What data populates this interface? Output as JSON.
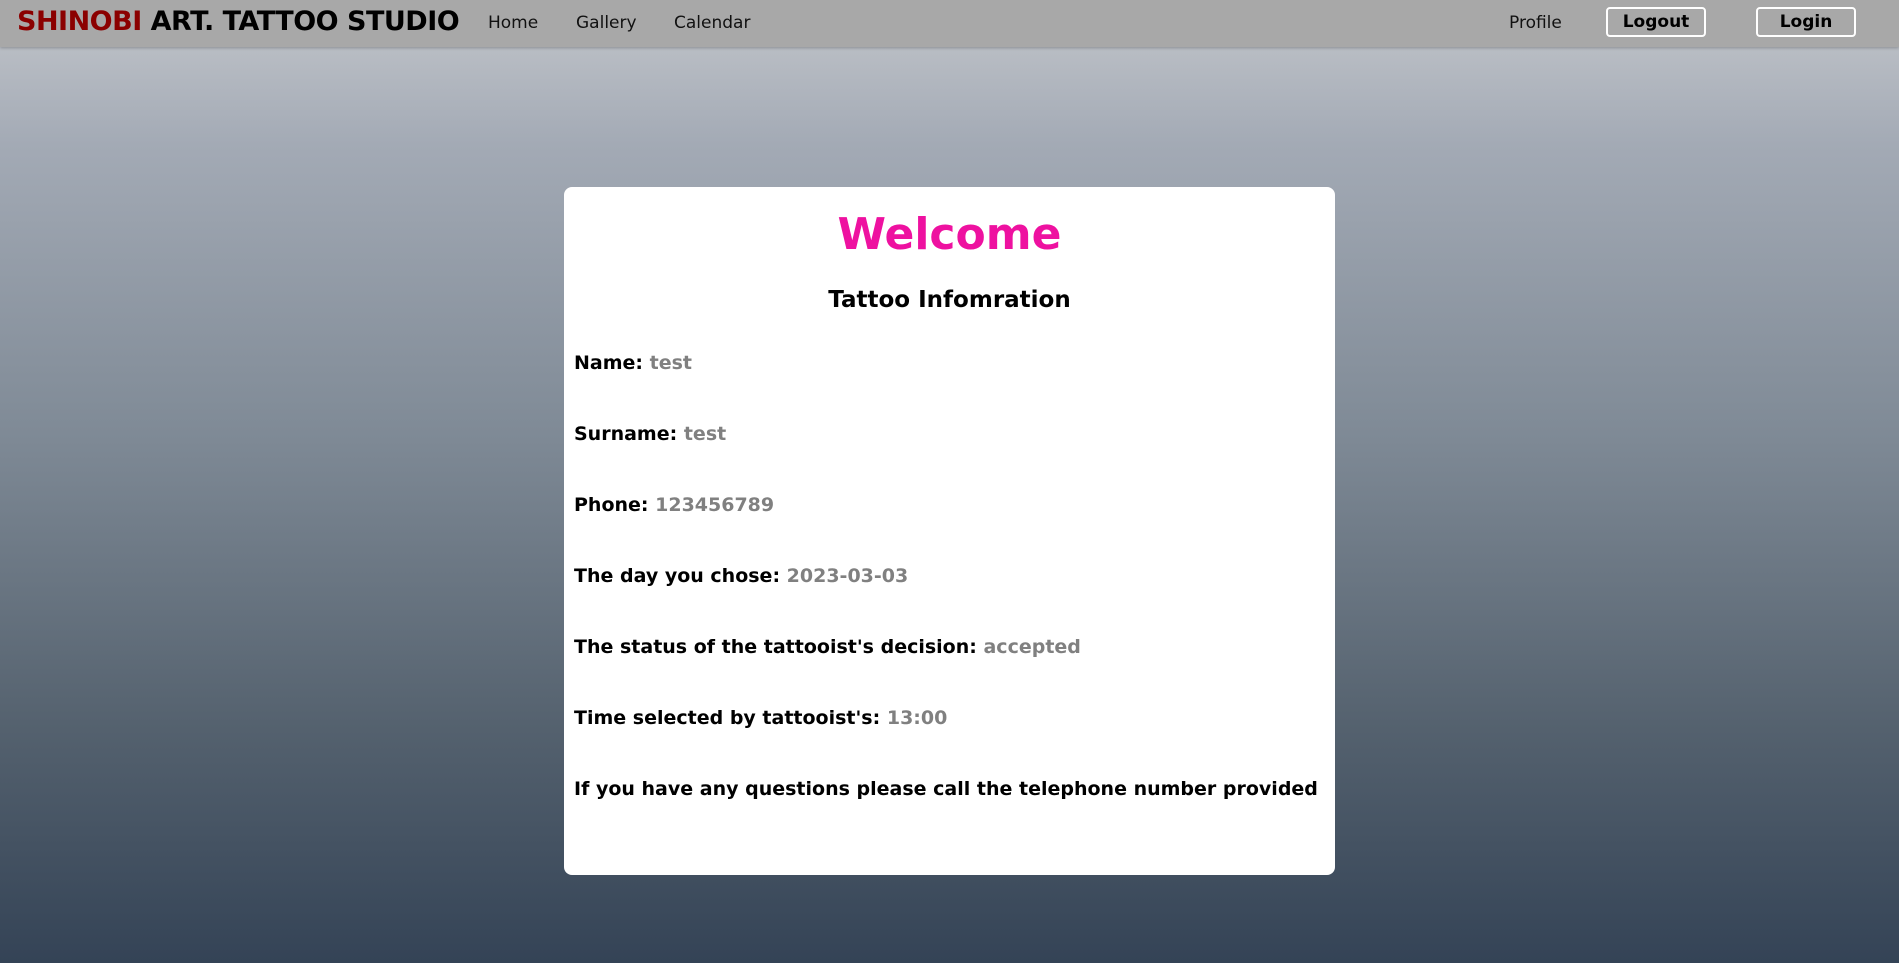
{
  "navbar": {
    "brand_accent": "SHINOBI",
    "brand_rest": " ART. TATTOO STUDIO",
    "links": [
      "Home",
      "Gallery",
      "Calendar"
    ],
    "profile": "Profile",
    "logout": "Logout",
    "login": "Login"
  },
  "card": {
    "welcome": "Welcome",
    "subtitle": "Tattoo Infomration",
    "rows": [
      {
        "label": "Name:",
        "value": "test"
      },
      {
        "label": "Surname:",
        "value": "test"
      },
      {
        "label": "Phone:",
        "value": "123456789"
      },
      {
        "label": "The day you chose:",
        "value": "2023-03-03"
      },
      {
        "label": "The status of the tattooist's decision:",
        "value": "accepted"
      },
      {
        "label": "Time selected by tattooist's:",
        "value": "13:00"
      }
    ],
    "footer": "If you have any questions please call the telephone number provided"
  },
  "colors": {
    "brand_accent": "#8b0000",
    "welcome": "#ee11a0",
    "value_text": "#808080",
    "navbar_bg": "#a8a8a8"
  }
}
